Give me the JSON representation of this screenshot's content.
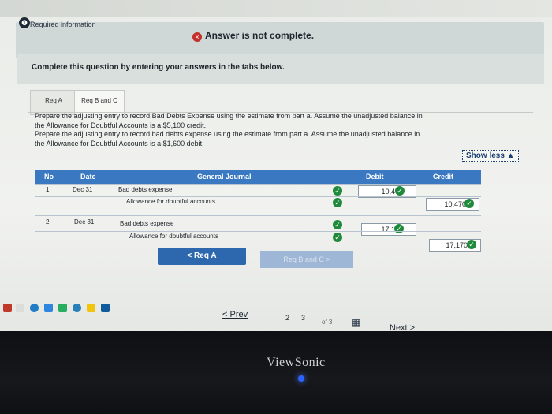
{
  "header": {
    "badge": "❶",
    "required_info": "Required information",
    "alert_text": "Answer is not complete."
  },
  "instruction": "Complete this question by entering your answers in the tabs below.",
  "tabs": [
    {
      "label": "Req A"
    },
    {
      "label": "Req B and C"
    }
  ],
  "prompt": {
    "line1": "Prepare the adjusting entry to record Bad Debts Expense using the estimate from part a. Assume the unadjusted balance in",
    "line2": "the Allowance for Doubtful Accounts is a $5,100 credit.",
    "line3": "Prepare the adjusting entry to record bad debts expense using the estimate from part a. Assume the unadjusted balance in",
    "line4": "the Allowance for Doubtful Accounts is a $1,600 debit."
  },
  "show_less": "Show less ▲",
  "journal": {
    "headers": {
      "no": "No",
      "date": "Date",
      "gj": "General Journal",
      "debit": "Debit",
      "credit": "Credit"
    },
    "rows": [
      {
        "no": "1",
        "date": "Dec 31",
        "account": "Bad debts expense",
        "debit": "10,470",
        "credit": ""
      },
      {
        "no": "",
        "date": "",
        "account": "Allowance for doubtful accounts",
        "debit": "",
        "credit": "10,470"
      },
      {
        "no": "2",
        "date": "Dec 31",
        "account": "Bad debts expense",
        "debit": "17,170",
        "credit": ""
      },
      {
        "no": "",
        "date": "",
        "account": "Allowance for doubtful accounts",
        "debit": "",
        "credit": "17,170"
      }
    ]
  },
  "buttons": {
    "prev_tab": "< Req A",
    "next_tab": "Req B and C >"
  },
  "pagination": {
    "prev": "< Prev",
    "page_2": "2",
    "page_3": "3",
    "of_label": "of 3",
    "next": "Next >"
  },
  "monitor": {
    "brand": "ViewSonic"
  },
  "colors": {
    "header_blue": "#3a78c2",
    "check_green": "#1f8a3c",
    "alert_red": "#c4302b"
  }
}
